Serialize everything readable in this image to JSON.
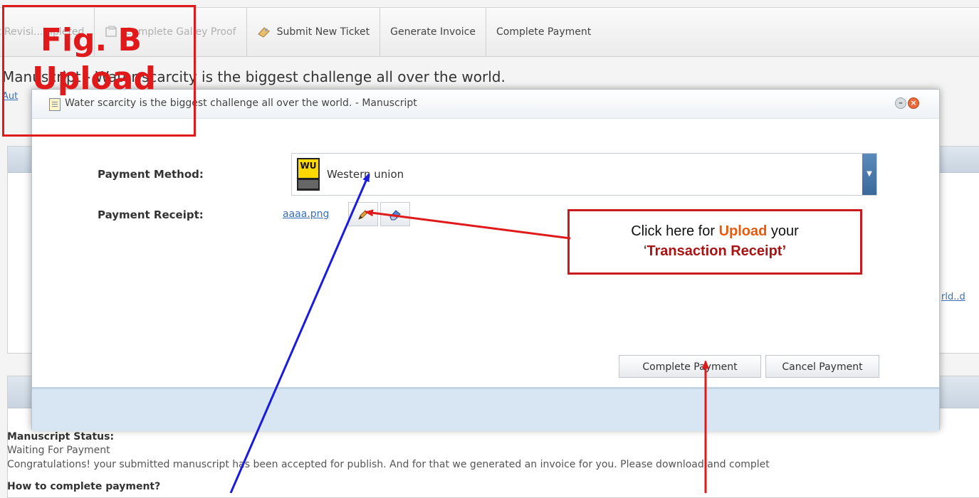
{
  "toolbar": {
    "items": [
      {
        "label": "t Revisi...mpleted",
        "faded": true
      },
      {
        "label": "Complete Galley Proof",
        "faded": true
      },
      {
        "label": "Submit New Ticket",
        "faded": false
      },
      {
        "label": "Generate Invoice",
        "faded": false
      },
      {
        "label": "Complete Payment",
        "faded": false
      }
    ]
  },
  "page": {
    "manuscript_title": "Manuscript - Water scarcity is the biggest challenge all over the world.",
    "author_link": "Aut",
    "right_stub_link": "rld..d",
    "status_label": "Manuscript Status:",
    "status_value": "Waiting For Payment",
    "status_message": "Congratulations! your submitted manuscript has been accepted for publish. And for that we generated an invoice for you. Please download and complet",
    "howto_heading": "How to complete payment?"
  },
  "modal": {
    "title": "Water scarcity is the biggest challenge all over the world. - Manuscript",
    "payment_method_label": "Payment Method:",
    "payment_method_value": "Western union",
    "payment_method_logo_text": "WU",
    "payment_receipt_label": "Payment Receipt:",
    "receipt_file": "aaaa.png",
    "complete_button": "Complete Payment",
    "cancel_button": "Cancel Payment"
  },
  "annotation": {
    "fig_line1": "Fig. B",
    "fig_line2": "Upload",
    "callout_pre": "Click here for ",
    "callout_highlight": "Upload",
    "callout_mid": " your",
    "callout_quote_open": "‘",
    "callout_bold": "Transaction Receipt’",
    "arrow_red": "#e01a1a",
    "arrow_blue": "#1a1ae0"
  }
}
